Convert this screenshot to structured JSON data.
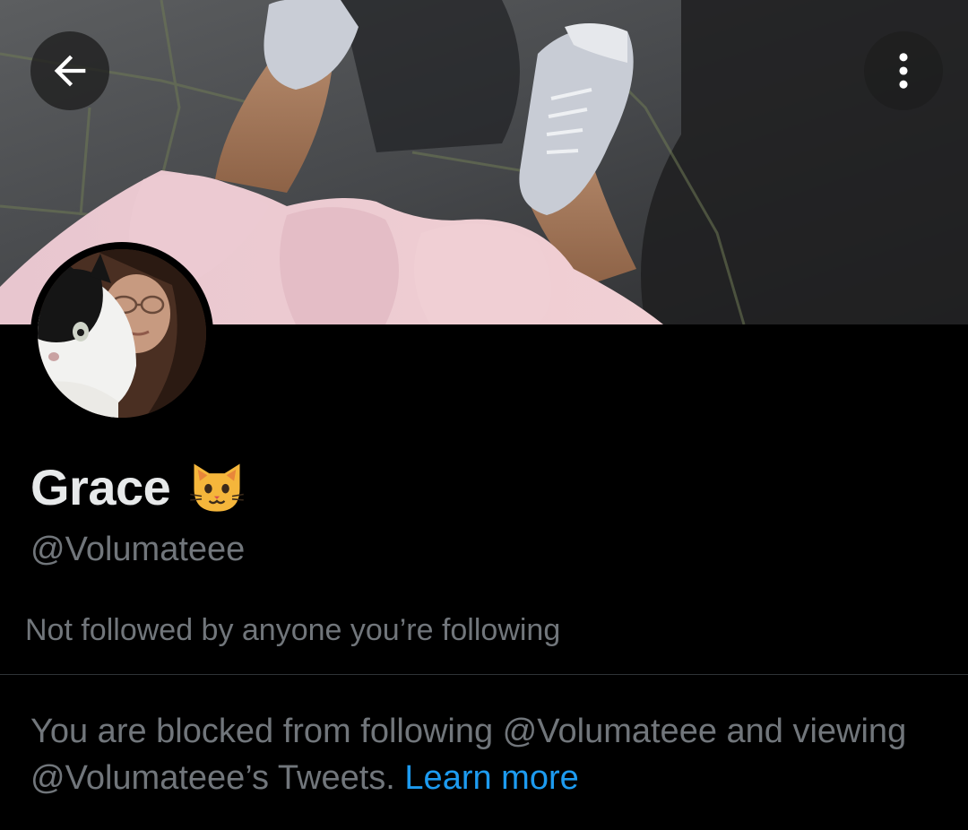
{
  "header": {
    "back_icon": "arrow-left-icon",
    "more_icon": "vertical-dots-icon"
  },
  "colors": {
    "background": "#000000",
    "text_primary": "#e7e9ea",
    "text_secondary": "#71767b",
    "link": "#1d9bf0",
    "divider": "#2f3336"
  },
  "profile": {
    "display_name": "Grace",
    "name_emoji_icon": "cat-face-emoji-icon",
    "handle": "@Volumateee",
    "followers_note": "Not followed by anyone you’re following"
  },
  "blocked": {
    "message": "You are blocked from following @Volumateee and viewing @Volumateee’s Tweets.",
    "learn_more": "Learn more"
  }
}
